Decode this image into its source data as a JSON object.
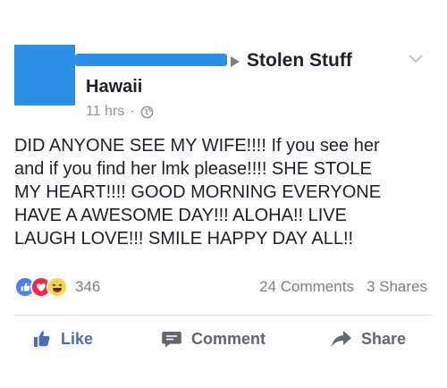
{
  "post": {
    "group_name": "Stolen Stuff",
    "location": "Hawaii",
    "time": "11 hrs",
    "separator": "·",
    "body": "DID ANYONE SEE MY WIFE!!!! If you see her\nand if you find her lmk please!!!!  SHE STOLE\nMY HEART!!!! GOOD MORNING EVERYONE\nHAVE A AWESOME DAY!!! ALOHA!! LIVE\nLAUGH LOVE!!! SMILE HAPPY DAY ALL!!"
  },
  "stats": {
    "reaction_count": "346",
    "comments": "24 Comments",
    "shares": "3 Shares"
  },
  "actions": {
    "like": "Like",
    "comment": "Comment",
    "share": "Share"
  },
  "colors": {
    "redaction": "#2b8fe6",
    "like_blue": "#4b6fb0",
    "love_red": "#f0284a",
    "haha_yellow": "#fcd34d",
    "muted": "#90949c"
  },
  "icons": {
    "privacy": "globe-icon",
    "menu": "chevron-down-icon",
    "reactions": [
      "like-reaction-icon",
      "love-reaction-icon",
      "haha-reaction-icon"
    ]
  }
}
